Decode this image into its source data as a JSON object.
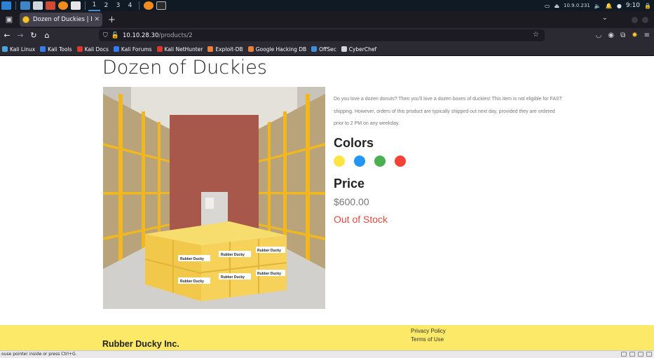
{
  "taskbar": {
    "workspaces": [
      "1",
      "2",
      "3",
      "4"
    ],
    "network_ip": "10.9.0.231",
    "clock": "9:10"
  },
  "browser": {
    "tab_title": "Dozen of Duckies | Rubber",
    "url_host": "10.10.28.30",
    "url_path": "/products/2",
    "bookmarks": [
      {
        "label": "Kali Linux",
        "color": "#4aa3df"
      },
      {
        "label": "Kali Tools",
        "color": "#367bf0"
      },
      {
        "label": "Kali Docs",
        "color": "#d93a2b"
      },
      {
        "label": "Kali Forums",
        "color": "#367bf0"
      },
      {
        "label": "Kali NetHunter",
        "color": "#d93a2b"
      },
      {
        "label": "Exploit-DB",
        "color": "#e8803a"
      },
      {
        "label": "Google Hacking DB",
        "color": "#e8803a"
      },
      {
        "label": "OffSec",
        "color": "#3f8fd8"
      },
      {
        "label": "CyberChef",
        "color": "#cfd5db"
      }
    ]
  },
  "product": {
    "title": "Dozen of Duckies",
    "description": "Do you love a dozen donuts? Then you'll love a dozen boxes of duckies! This item is not eligible for FAST shipping. However, orders of this product are typically shipped out next day, provided they are ordered prior to 2 PM on any weekday.",
    "colors_heading": "Colors",
    "colors": [
      "#fde443",
      "#2196f3",
      "#4caf50",
      "#f44336"
    ],
    "price_heading": "Price",
    "price": "$600.00",
    "stock_status": "Out of Stock",
    "box_label": "Rubber Ducky"
  },
  "footer": {
    "brand": "Rubber Ducky Inc.",
    "links": [
      "Privacy Policy",
      "Terms of Use"
    ]
  },
  "statusbar": {
    "message": "ouse pointer inside or press Ctrl+G."
  }
}
